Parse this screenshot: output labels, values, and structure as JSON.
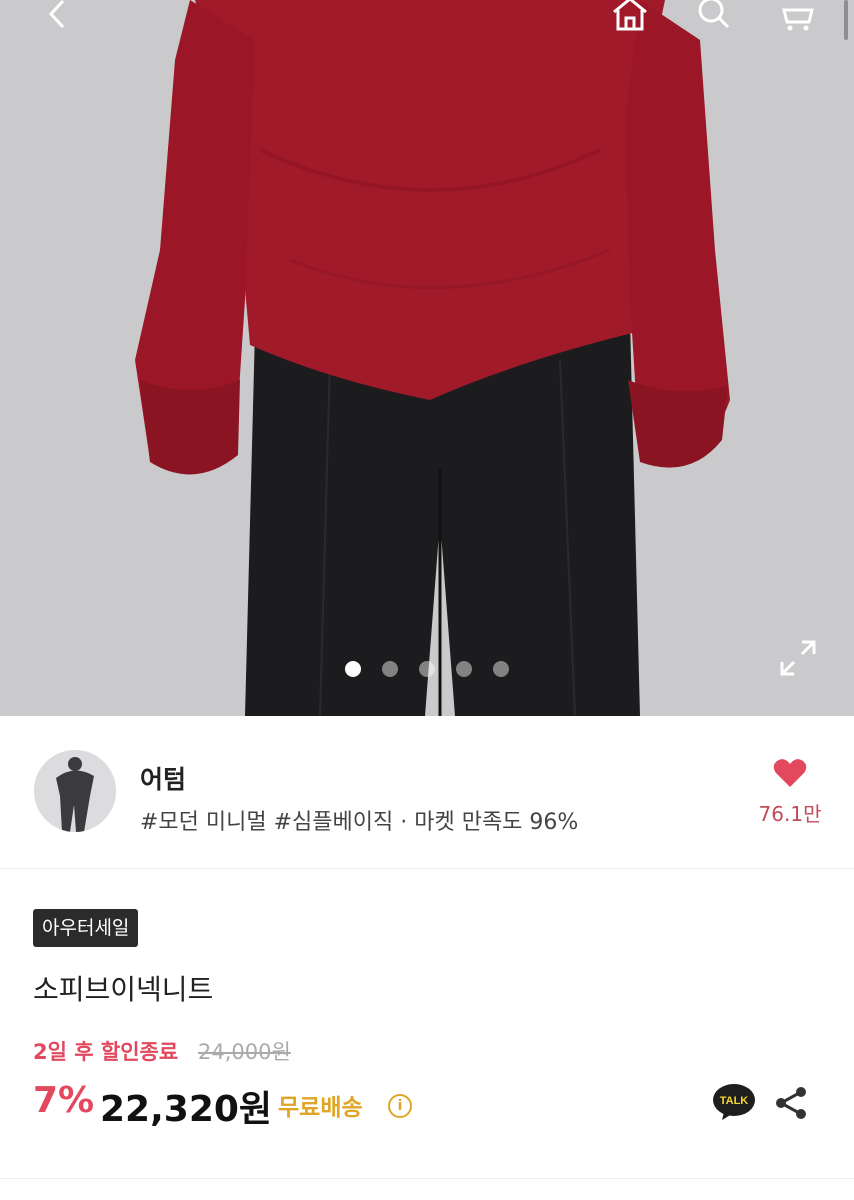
{
  "header": {
    "icons": [
      "back-icon",
      "home-icon",
      "search-icon",
      "cart-icon"
    ]
  },
  "gallery": {
    "image_count": 5,
    "active_index": 0,
    "expand_icon": "expand-icon"
  },
  "seller": {
    "name": "어텀",
    "tags": "#모던 미니멀 #심플베이직 · 마켓 만족도 96%",
    "like_count": "76.1만",
    "like_icon": "heart-icon"
  },
  "product": {
    "badge": "아우터세일",
    "title": "소피브이넥니트",
    "countdown": "2일 후 할인종료",
    "original_price": "24,000원",
    "discount": "7%",
    "price": "22,320원",
    "shipping": "무료배송",
    "info_icon": "i",
    "talk_label": "TALK",
    "share_icon": "share-icon"
  },
  "colors": {
    "accent_pink": "#e2495e",
    "shipping_gold": "#e0a526",
    "sweater_red": "#a21a2a"
  }
}
